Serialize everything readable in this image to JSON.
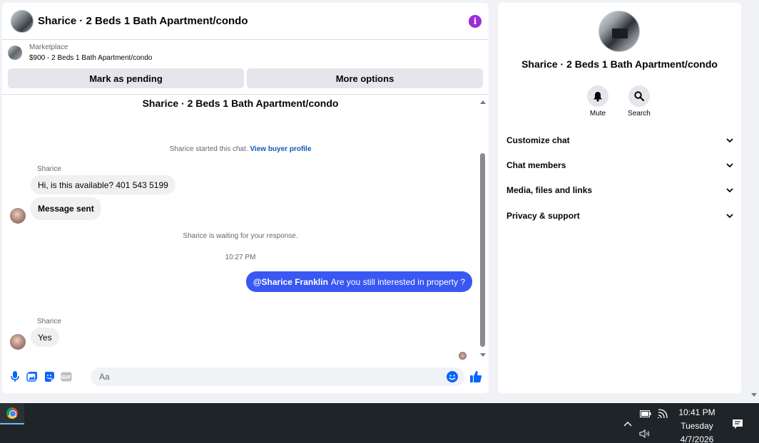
{
  "header": {
    "title": "Sharice · 2 Beds 1 Bath Apartment/condo"
  },
  "marketplace": {
    "label": "Marketplace",
    "listing": "$900 - 2 Beds 1 Bath Apartment/condo"
  },
  "actions": {
    "mark_pending": "Mark as pending",
    "more_options": "More options"
  },
  "conversation": {
    "title": "Sharice · 2 Beds 1 Bath Apartment/condo",
    "started_text": "Sharice started this chat.",
    "buyer_profile_link": "View buyer profile",
    "sender_name": "Sharice",
    "msg1": "Hi, is this available? 401 543 5199",
    "msg2": "Message sent",
    "waiting_text": "Sharice is waiting for your response.",
    "timestamp": "10:27 PM",
    "outgoing_mention": "@Sharice Franklin",
    "outgoing_text": "Are you still interested in property ?",
    "sender_name_2": "Sharice",
    "msg3": "Yes"
  },
  "composer": {
    "placeholder": "Aa"
  },
  "info_panel": {
    "title": "Sharice · 2 Beds 1 Bath Apartment/condo",
    "mute_label": "Mute",
    "search_label": "Search",
    "sections": [
      "Customize chat",
      "Chat members",
      "Media, files and links",
      "Privacy & support"
    ]
  },
  "taskbar": {
    "time": "10:41 PM",
    "day": "Tuesday",
    "date": "4/7/2026"
  },
  "colors": {
    "accent": "#3a57f2",
    "info": "#9d2cd8",
    "link": "#0a5ab7",
    "composer_icons": "#0866ff"
  }
}
